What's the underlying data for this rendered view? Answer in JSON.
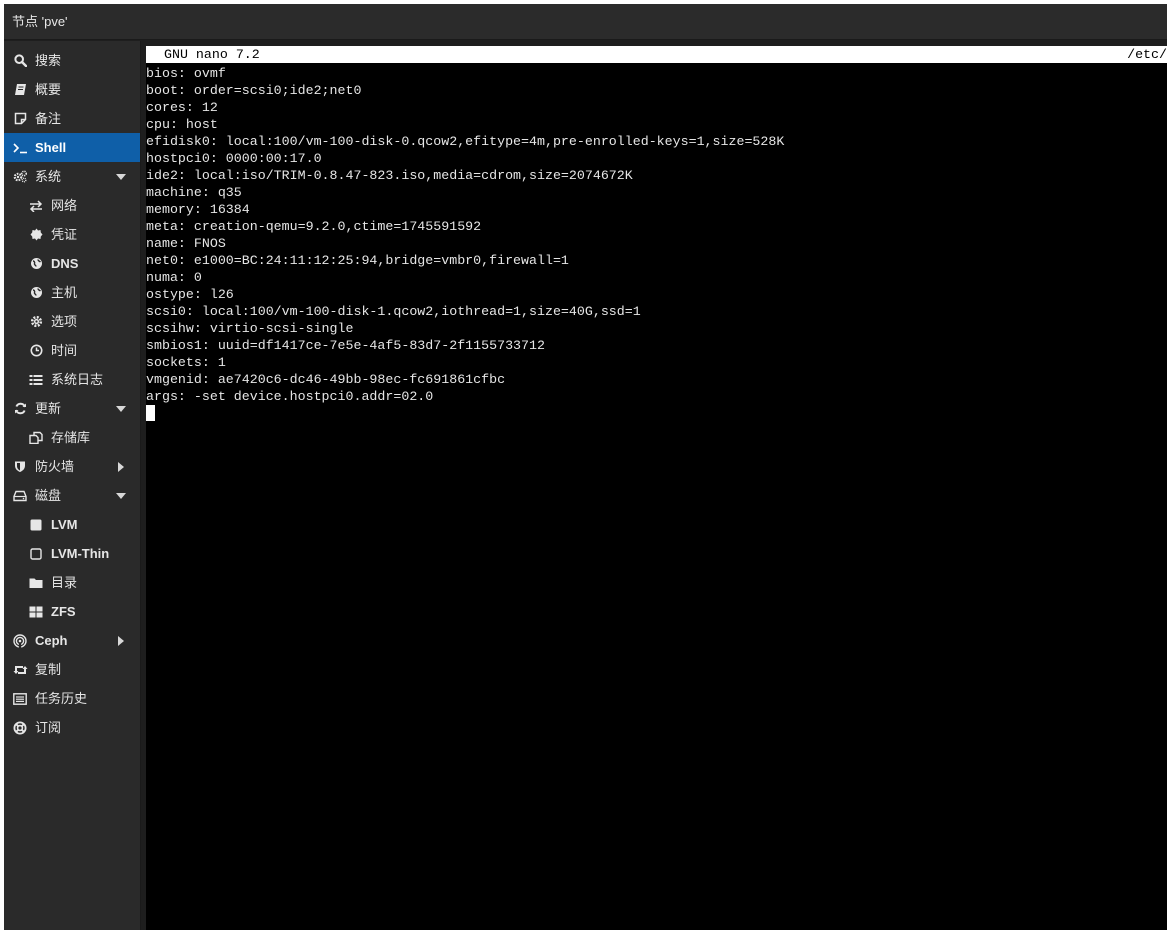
{
  "window": {
    "title": "节点 'pve'"
  },
  "sidebar": {
    "items": [
      {
        "label": "搜索",
        "icon": "search-icon",
        "level": 1,
        "bold": false
      },
      {
        "label": "概要",
        "icon": "book-icon",
        "level": 1,
        "bold": false
      },
      {
        "label": "备注",
        "icon": "note-icon",
        "level": 1,
        "bold": false
      },
      {
        "label": "Shell",
        "icon": "terminal-icon",
        "level": 1,
        "bold": true,
        "active": true
      },
      {
        "label": "系统",
        "icon": "gears-icon",
        "level": 1,
        "bold": false,
        "arrow": "down"
      },
      {
        "label": "网络",
        "icon": "exchange-icon",
        "level": 2,
        "bold": false
      },
      {
        "label": "凭证",
        "icon": "certificate-icon",
        "level": 2,
        "bold": false
      },
      {
        "label": "DNS",
        "icon": "globe-icon",
        "level": 2,
        "bold": true
      },
      {
        "label": "主机",
        "icon": "globe-icon",
        "level": 2,
        "bold": false
      },
      {
        "label": "选项",
        "icon": "gear-icon",
        "level": 2,
        "bold": false
      },
      {
        "label": "时间",
        "icon": "clock-icon",
        "level": 2,
        "bold": false
      },
      {
        "label": "系统日志",
        "icon": "list-icon",
        "level": 2,
        "bold": false
      },
      {
        "label": "更新",
        "icon": "refresh-icon",
        "level": 1,
        "bold": false,
        "arrow": "down"
      },
      {
        "label": "存储库",
        "icon": "files-icon",
        "level": 2,
        "bold": false
      },
      {
        "label": "防火墙",
        "icon": "shield-icon",
        "level": 1,
        "bold": false,
        "arrow": "right"
      },
      {
        "label": "磁盘",
        "icon": "hdd-icon",
        "level": 1,
        "bold": false,
        "arrow": "down"
      },
      {
        "label": "LVM",
        "icon": "square-icon",
        "level": 2,
        "bold": true
      },
      {
        "label": "LVM-Thin",
        "icon": "square-outline-icon",
        "level": 2,
        "bold": true
      },
      {
        "label": "目录",
        "icon": "folder-icon",
        "level": 2,
        "bold": false
      },
      {
        "label": "ZFS",
        "icon": "grid-icon",
        "level": 2,
        "bold": true
      },
      {
        "label": "Ceph",
        "icon": "ceph-icon",
        "level": 1,
        "bold": true,
        "arrow": "right"
      },
      {
        "label": "复制",
        "icon": "retweet-icon",
        "level": 1,
        "bold": false
      },
      {
        "label": "任务历史",
        "icon": "list-alt-icon",
        "level": 1,
        "bold": false
      },
      {
        "label": "订阅",
        "icon": "support-icon",
        "level": 1,
        "bold": false
      }
    ]
  },
  "terminal": {
    "header_left": "GNU nano 7.2",
    "header_right": "/etc/",
    "lines": [
      "bios: ovmf",
      "boot: order=scsi0;ide2;net0",
      "cores: 12",
      "cpu: host",
      "efidisk0: local:100/vm-100-disk-0.qcow2,efitype=4m,pre-enrolled-keys=1,size=528K",
      "hostpci0: 0000:00:17.0",
      "ide2: local:iso/TRIM-0.8.47-823.iso,media=cdrom,size=2074672K",
      "machine: q35",
      "memory: 16384",
      "meta: creation-qemu=9.2.0,ctime=1745591592",
      "name: FNOS",
      "net0: e1000=BC:24:11:12:25:94,bridge=vmbr0,firewall=1",
      "numa: 0",
      "ostype: l26",
      "scsi0: local:100/vm-100-disk-1.qcow2,iothread=1,size=40G,ssd=1",
      "scsihw: virtio-scsi-single",
      "smbios1: uuid=df1417ce-7e5e-4af5-83d7-2f1155733712",
      "sockets: 1",
      "vmgenid: ae7420c6-dc46-49bb-98ec-fc691861cfbc",
      "args: -set device.hostpci0.addr=02.0"
    ]
  },
  "colors": {
    "active": "#0f5fa8",
    "sidebar_bg": "#2a2a2a",
    "terminal_bg": "#000000"
  }
}
